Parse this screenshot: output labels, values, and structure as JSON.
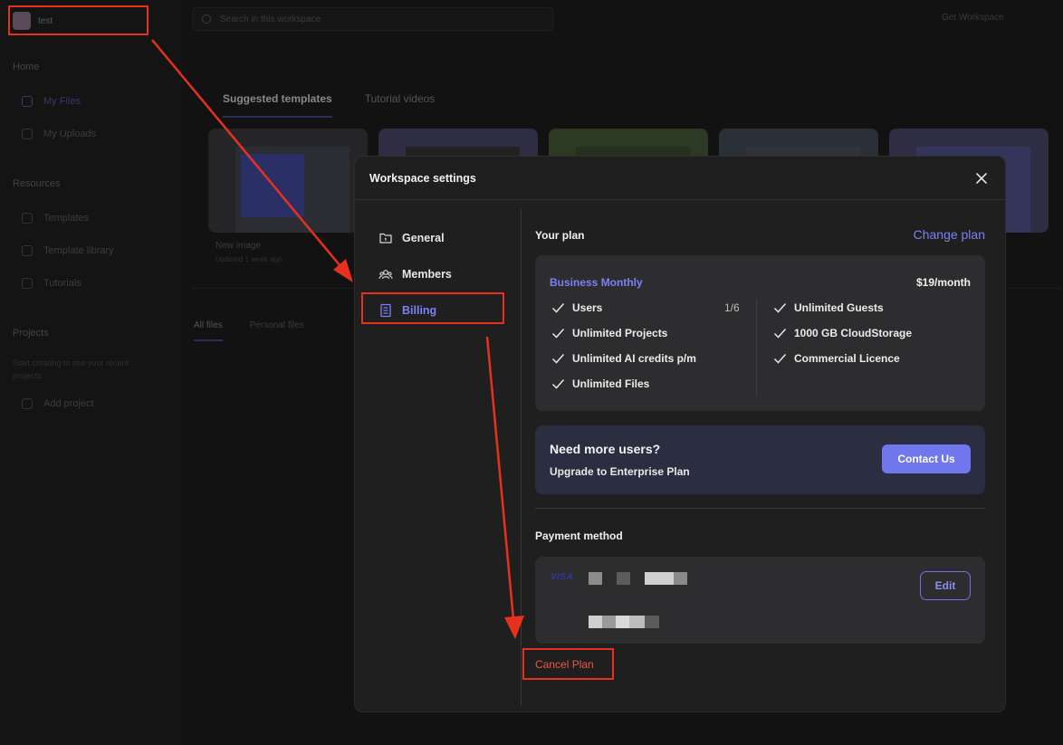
{
  "background": {
    "workspace_name": "test",
    "search_placeholder": "Search in this workspace",
    "top_right": "Get Workspace",
    "sidebar": {
      "home_heading": "Home",
      "home_items": [
        "My Files",
        "My Uploads"
      ],
      "resources_heading": "Resources",
      "resources_items": [
        "Templates",
        "Template library",
        "Tutorials"
      ],
      "projects_heading": "Projects",
      "projects_text": "Start creating to see your recent projects",
      "add_project": "Add project"
    },
    "tabs": [
      "Suggested templates",
      "Tutorial videos"
    ],
    "card_label": "New image",
    "card_sub": "Updated 1 week ago",
    "files_tabs": [
      "All files",
      "Personal files"
    ]
  },
  "modal": {
    "title": "Workspace settings",
    "nav": [
      {
        "label": "General",
        "icon": "folder-icon"
      },
      {
        "label": "Members",
        "icon": "users-icon"
      },
      {
        "label": "Billing",
        "icon": "receipt-icon"
      }
    ],
    "active_nav": "Billing",
    "plan": {
      "heading": "Your plan",
      "change_plan": "Change plan",
      "name": "Business Monthly",
      "price": "$19/month",
      "features_left": [
        "Users",
        "Unlimited Projects",
        "Unlimited AI credits p/m",
        "Unlimited Files"
      ],
      "users_count": "1/6",
      "features_right": [
        "Unlimited Guests",
        "1000 GB CloudStorage",
        "Commercial Licence"
      ]
    },
    "enterprise": {
      "title": "Need more users?",
      "subtitle": "Upgrade to Enterprise Plan",
      "button": "Contact Us"
    },
    "payment": {
      "heading": "Payment method",
      "brand": "VISA",
      "edit": "Edit"
    },
    "cancel_plan": "Cancel Plan"
  },
  "colors": {
    "accent": "#7b80f5",
    "danger": "#ef5350",
    "annotation": "#e8301f"
  }
}
